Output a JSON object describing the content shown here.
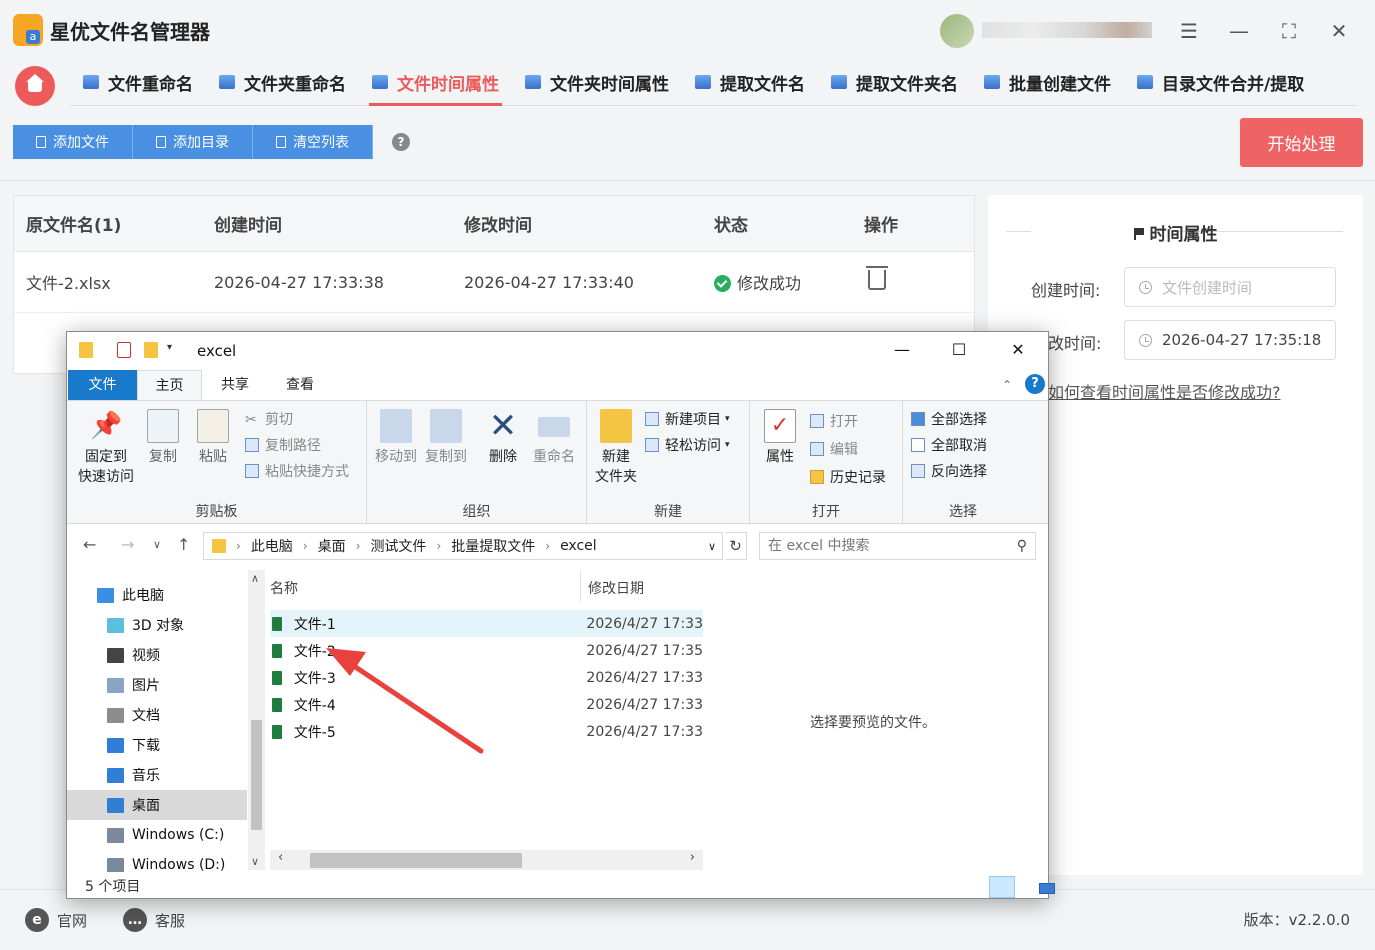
{
  "app": {
    "title": "星优文件名管理器",
    "version": "版本：v2.2.0.0"
  },
  "tabs": [
    {
      "label": "文件重命名"
    },
    {
      "label": "文件夹重命名"
    },
    {
      "label": "文件时间属性"
    },
    {
      "label": "文件夹时间属性"
    },
    {
      "label": "提取文件名"
    },
    {
      "label": "提取文件夹名"
    },
    {
      "label": "批量创建文件"
    },
    {
      "label": "目录文件合并/提取"
    }
  ],
  "toolbar": {
    "add_file": "添加文件",
    "add_dir": "添加目录",
    "clear_list": "清空列表",
    "help": "?",
    "start": "开始处理"
  },
  "table": {
    "headers": {
      "name": "原文件名(1)",
      "created": "创建时间",
      "modified": "修改时间",
      "status": "状态",
      "action": "操作"
    },
    "rows": [
      {
        "name": "文件-2.xlsx",
        "created": "2026-04-27 17:33:38",
        "modified": "2026-04-27 17:33:40",
        "status": "修改成功"
      }
    ]
  },
  "panel": {
    "title": "时间属性",
    "created_label": "创建时间:",
    "created_placeholder": "文件创建时间",
    "modified_label": "改时间:",
    "modified_value": "2026-04-27 17:35:18",
    "help_link": "如何查看时间属性是否修改成功?"
  },
  "footer": {
    "website": "官网",
    "service": "客服"
  },
  "explorer": {
    "title": "excel",
    "ribbon_tabs": {
      "file": "文件",
      "home": "主页",
      "share": "共享",
      "view": "查看"
    },
    "clipboard": {
      "pin": "固定到",
      "pin2": "快速访问",
      "copy": "复制",
      "paste": "粘贴",
      "cut": "剪切",
      "copy_path": "复制路径",
      "paste_shortcut": "粘贴快捷方式",
      "group": "剪贴板"
    },
    "organize": {
      "move_to": "移动到",
      "copy_to": "复制到",
      "delete": "删除",
      "rename": "重命名",
      "group": "组织"
    },
    "new": {
      "new_folder": "新建",
      "new_folder2": "文件夹",
      "new_item": "新建项目",
      "easy_access": "轻松访问",
      "group": "新建"
    },
    "open": {
      "properties": "属性",
      "open": "打开",
      "edit": "编辑",
      "history": "历史记录",
      "group": "打开"
    },
    "select": {
      "select_all": "全部选择",
      "select_none": "全部取消",
      "invert": "反向选择",
      "group": "选择"
    },
    "breadcrumb": [
      "此电脑",
      "桌面",
      "测试文件",
      "批量提取文件",
      "excel"
    ],
    "search_placeholder": "在 excel 中搜索",
    "nav": [
      {
        "label": "此电脑",
        "color": "#3a8ee6"
      },
      {
        "label": "3D 对象",
        "color": "#5bc0de"
      },
      {
        "label": "视频",
        "color": "#444444"
      },
      {
        "label": "图片",
        "color": "#8aa4c8"
      },
      {
        "label": "文档",
        "color": "#8c8c8c"
      },
      {
        "label": "下载",
        "color": "#2f7fd6"
      },
      {
        "label": "音乐",
        "color": "#2f7fd6"
      },
      {
        "label": "桌面",
        "color": "#2f7fd6"
      },
      {
        "label": "Windows (C:)",
        "color": "#7b8a9a"
      },
      {
        "label": "Windows (D:)",
        "color": "#7b8a9a"
      }
    ],
    "columns": {
      "name": "名称",
      "date": "修改日期"
    },
    "files": [
      {
        "name": "文件-1",
        "date": "2026/4/27 17:33"
      },
      {
        "name": "文件-2",
        "date": "2026/4/27 17:35"
      },
      {
        "name": "文件-3",
        "date": "2026/4/27 17:33"
      },
      {
        "name": "文件-4",
        "date": "2026/4/27 17:33"
      },
      {
        "name": "文件-5",
        "date": "2026/4/27 17:33"
      }
    ],
    "preview_text": "选择要预览的文件。",
    "status": "5 个项目"
  },
  "colors": {
    "accent": "#ec5a5a",
    "button_blue": "#4a90e2",
    "success": "#27ae60",
    "arrow": "#e8413e"
  }
}
